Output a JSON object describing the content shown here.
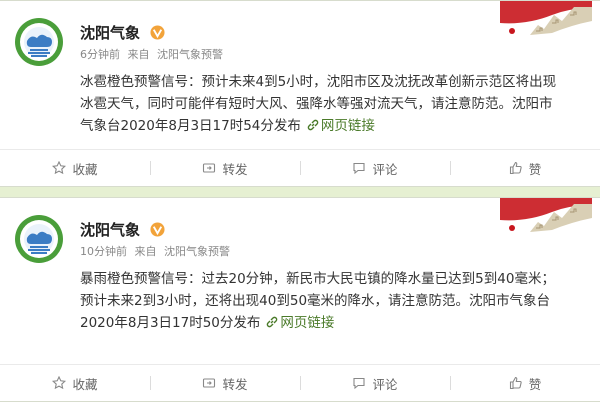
{
  "posts": [
    {
      "account": "沈阳气象",
      "time": "6分钟前",
      "source_prefix": "来自",
      "source": "沈阳气象预警",
      "lines": [
        "冰雹橙色预警信号：预计未来4到5小时，沈阳市区及沈抚改革创新示范区将出现",
        "冰雹天气，同时可能伴有短时大风、强降水等强对流天气，请注意防范。沈阳市",
        "气象台2020年8月3日17时54分发布"
      ],
      "link_label": "网页链接",
      "actions": {
        "favorite": "收藏",
        "repost": "转发",
        "comment": "评论",
        "like": "赞"
      }
    },
    {
      "account": "沈阳气象",
      "time": "10分钟前",
      "source_prefix": "来自",
      "source": "沈阳气象预警",
      "lines": [
        "暴雨橙色预警信号：过去20分钟，新民市大民屯镇的降水量已达到5到40毫米；",
        "预计未来2到3小时，还将出现40到50毫米的降水，请注意防范。沈阳市气象台",
        "2020年8月3日17时50分发布"
      ],
      "link_label": "网页链接",
      "actions": {
        "favorite": "收藏",
        "repost": "转发",
        "comment": "评论",
        "like": "赞"
      }
    }
  ],
  "colors": {
    "page_background": "#e6f0d2",
    "link_green": "#4a7a29",
    "verified_badge": "#f2a33a",
    "avatar_ring": "#4a9e3a"
  },
  "icons": [
    "avatar-logo-icon",
    "verified-icon",
    "link-icon",
    "star-icon",
    "repost-icon",
    "comment-icon",
    "like-icon",
    "great-wall-decoration"
  ]
}
